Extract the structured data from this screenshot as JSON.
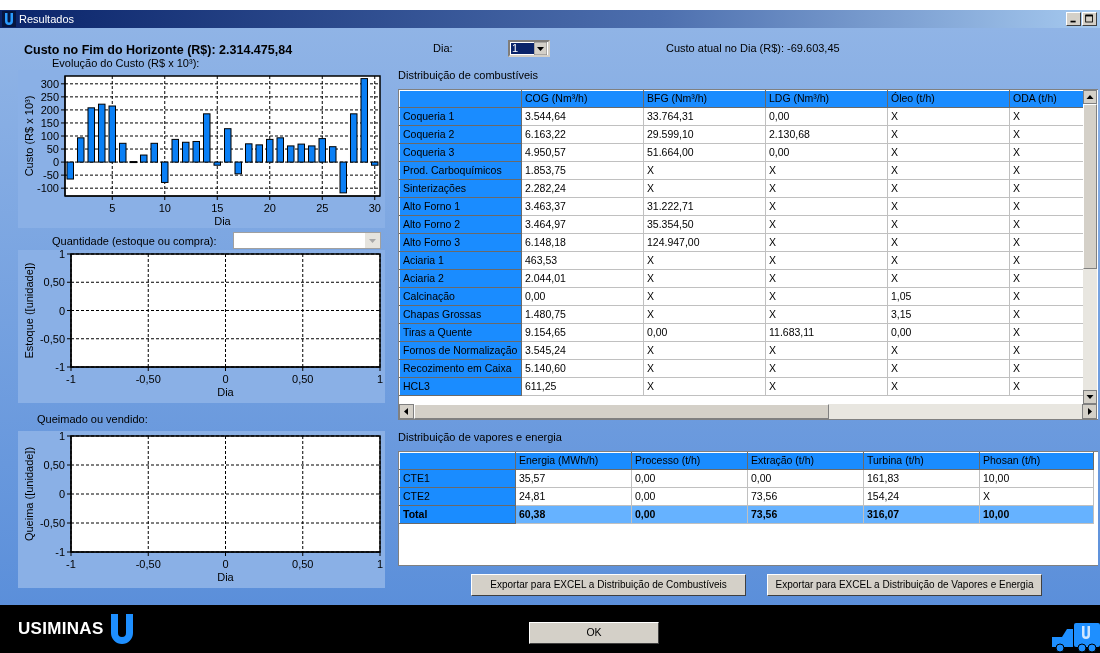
{
  "window": {
    "title": "Resultados"
  },
  "horizon_cost": "Custo no Fim do Horizonte (R$): 2.314.475,84",
  "cost_chart": {
    "label": "Evolução do Custo (R$ x 10³):",
    "chart_data": {
      "type": "bar",
      "xlabel": "Dia",
      "ylabel": "Custo (R$ x 10³)",
      "grid": true,
      "x": [
        1,
        2,
        3,
        4,
        5,
        6,
        7,
        8,
        9,
        10,
        11,
        12,
        13,
        14,
        15,
        16,
        17,
        18,
        19,
        20,
        21,
        22,
        23,
        24,
        25,
        26,
        27,
        28,
        29,
        30
      ],
      "series": [
        {
          "color": "#0a7ff5",
          "values": [
            -65,
            93,
            208,
            222,
            215,
            72,
            2,
            27,
            72,
            -78,
            87,
            76,
            79,
            185,
            -12,
            128,
            -45,
            70,
            66,
            87,
            93,
            62,
            69,
            62,
            90,
            59,
            -118,
            185,
            320,
            -12
          ]
        }
      ],
      "xlim": [
        0.5,
        30.5
      ],
      "ylim": [
        -130,
        330
      ],
      "xticks": [
        5,
        10,
        15,
        20,
        25,
        30
      ],
      "yticks": [
        -100,
        -50,
        0,
        50,
        100,
        150,
        200,
        250,
        300
      ]
    }
  },
  "quantity": {
    "label": "Quantidade (estoque ou compra):",
    "chart_data": {
      "type": "line",
      "grid": true,
      "xlabel": "Dia",
      "ylabel": "Estoque ([unidade])",
      "xlim": [
        -1,
        1
      ],
      "ylim": [
        -1,
        1
      ],
      "xticks": [
        {
          "value": -1,
          "label": "-1"
        },
        {
          "value": -0.5,
          "label": "-0,50"
        },
        {
          "value": 0,
          "label": "0"
        },
        {
          "value": 0.5,
          "label": "0,50"
        },
        {
          "value": 1,
          "label": "1"
        }
      ],
      "yticks": [
        {
          "value": -1,
          "label": "-1"
        },
        {
          "value": -0.5,
          "label": "-0,50"
        },
        {
          "value": 0,
          "label": "0"
        },
        {
          "value": 0.5,
          "label": "0,50"
        },
        {
          "value": 1,
          "label": "1"
        }
      ]
    }
  },
  "burned": {
    "label": "Queimado ou vendido:",
    "chart_data": {
      "type": "line",
      "grid": true,
      "xlabel": "Dia",
      "ylabel": "Queima ([unidade])",
      "xlim": [
        -1,
        1
      ],
      "ylim": [
        -1,
        1
      ],
      "xticks": [
        {
          "value": -1,
          "label": "-1"
        },
        {
          "value": -0.5,
          "label": "-0,50"
        },
        {
          "value": 0,
          "label": "0"
        },
        {
          "value": 0.5,
          "label": "0,50"
        },
        {
          "value": 1,
          "label": "1"
        }
      ],
      "yticks": [
        {
          "value": -1,
          "label": "-1"
        },
        {
          "value": -0.5,
          "label": "-0,50"
        },
        {
          "value": 0,
          "label": "0"
        },
        {
          "value": 0.5,
          "label": "0,50"
        },
        {
          "value": 1,
          "label": "1"
        }
      ]
    }
  },
  "day": {
    "label": "Dia:",
    "value": "1"
  },
  "current_cost": "Custo atual no Dia (R$): -69.603,45",
  "fuel_table": {
    "title": "Distribuição de combustíveis",
    "columns": [
      "COG (Nm³/h)",
      "BFG (Nm³/h)",
      "LDG (Nm³/h)",
      "Óleo (t/h)",
      "ODA (t/h)"
    ],
    "rows": [
      {
        "name": "Coqueria 1",
        "cells": [
          "3.544,64",
          "33.764,31",
          "0,00",
          "X",
          "X"
        ]
      },
      {
        "name": "Coqueria 2",
        "cells": [
          "6.163,22",
          "29.599,10",
          "2.130,68",
          "X",
          "X"
        ]
      },
      {
        "name": "Coqueria 3",
        "cells": [
          "4.950,57",
          "51.664,00",
          "0,00",
          "X",
          "X"
        ]
      },
      {
        "name": "Prod. Carboquímicos",
        "cells": [
          "1.853,75",
          "X",
          "X",
          "X",
          "X"
        ]
      },
      {
        "name": "Sinterizações",
        "cells": [
          "2.282,24",
          "X",
          "X",
          "X",
          "X"
        ]
      },
      {
        "name": "Alto Forno 1",
        "cells": [
          "3.463,37",
          "31.222,71",
          "X",
          "X",
          "X"
        ]
      },
      {
        "name": "Alto Forno 2",
        "cells": [
          "3.464,97",
          "35.354,50",
          "X",
          "X",
          "X"
        ]
      },
      {
        "name": "Alto Forno 3",
        "cells": [
          "6.148,18",
          "124.947,00",
          "X",
          "X",
          "X"
        ]
      },
      {
        "name": "Aciaria 1",
        "cells": [
          "463,53",
          "X",
          "X",
          "X",
          "X"
        ]
      },
      {
        "name": "Aciaria 2",
        "cells": [
          "2.044,01",
          "X",
          "X",
          "X",
          "X"
        ]
      },
      {
        "name": "Calcinação",
        "cells": [
          "0,00",
          "X",
          "X",
          "1,05",
          "X"
        ]
      },
      {
        "name": "Chapas Grossas",
        "cells": [
          "1.480,75",
          "X",
          "X",
          "3,15",
          "X"
        ]
      },
      {
        "name": "Tiras a Quente",
        "cells": [
          "9.154,65",
          "0,00",
          "11.683,11",
          "0,00",
          "X"
        ]
      },
      {
        "name": "Fornos de Normalização",
        "cells": [
          "3.545,24",
          "X",
          "X",
          "X",
          "X"
        ]
      },
      {
        "name": "Recozimento em Caixa",
        "cells": [
          "5.140,60",
          "X",
          "X",
          "X",
          "X"
        ]
      },
      {
        "name": "HCL3",
        "cells": [
          "611,25",
          "X",
          "X",
          "X",
          "X"
        ]
      }
    ]
  },
  "steam_table": {
    "title": "Distribuição de vapores e energia",
    "columns": [
      "Energia (MWh/h)",
      "Processo (t/h)",
      "Extração (t/h)",
      "Turbina (t/h)",
      "Phosan (t/h)"
    ],
    "rows": [
      {
        "kind": "data",
        "name": "CTE1",
        "cells": [
          "35,57",
          "0,00",
          "0,00",
          "161,83",
          "10,00"
        ]
      },
      {
        "kind": "data",
        "name": "CTE2",
        "cells": [
          "24,81",
          "0,00",
          "73,56",
          "154,24",
          "X"
        ]
      },
      {
        "kind": "total",
        "name": "Total",
        "cells": [
          "60,38",
          "0,00",
          "73,56",
          "316,07",
          "10,00"
        ]
      }
    ]
  },
  "buttons": [
    "Exportar para EXCEL a Distribuição de Combustíveis",
    "Exportar para EXCEL a Distribuição de Vapores e Energia"
  ],
  "footer": {
    "logo": "USIMINAS",
    "ok": "OK"
  }
}
